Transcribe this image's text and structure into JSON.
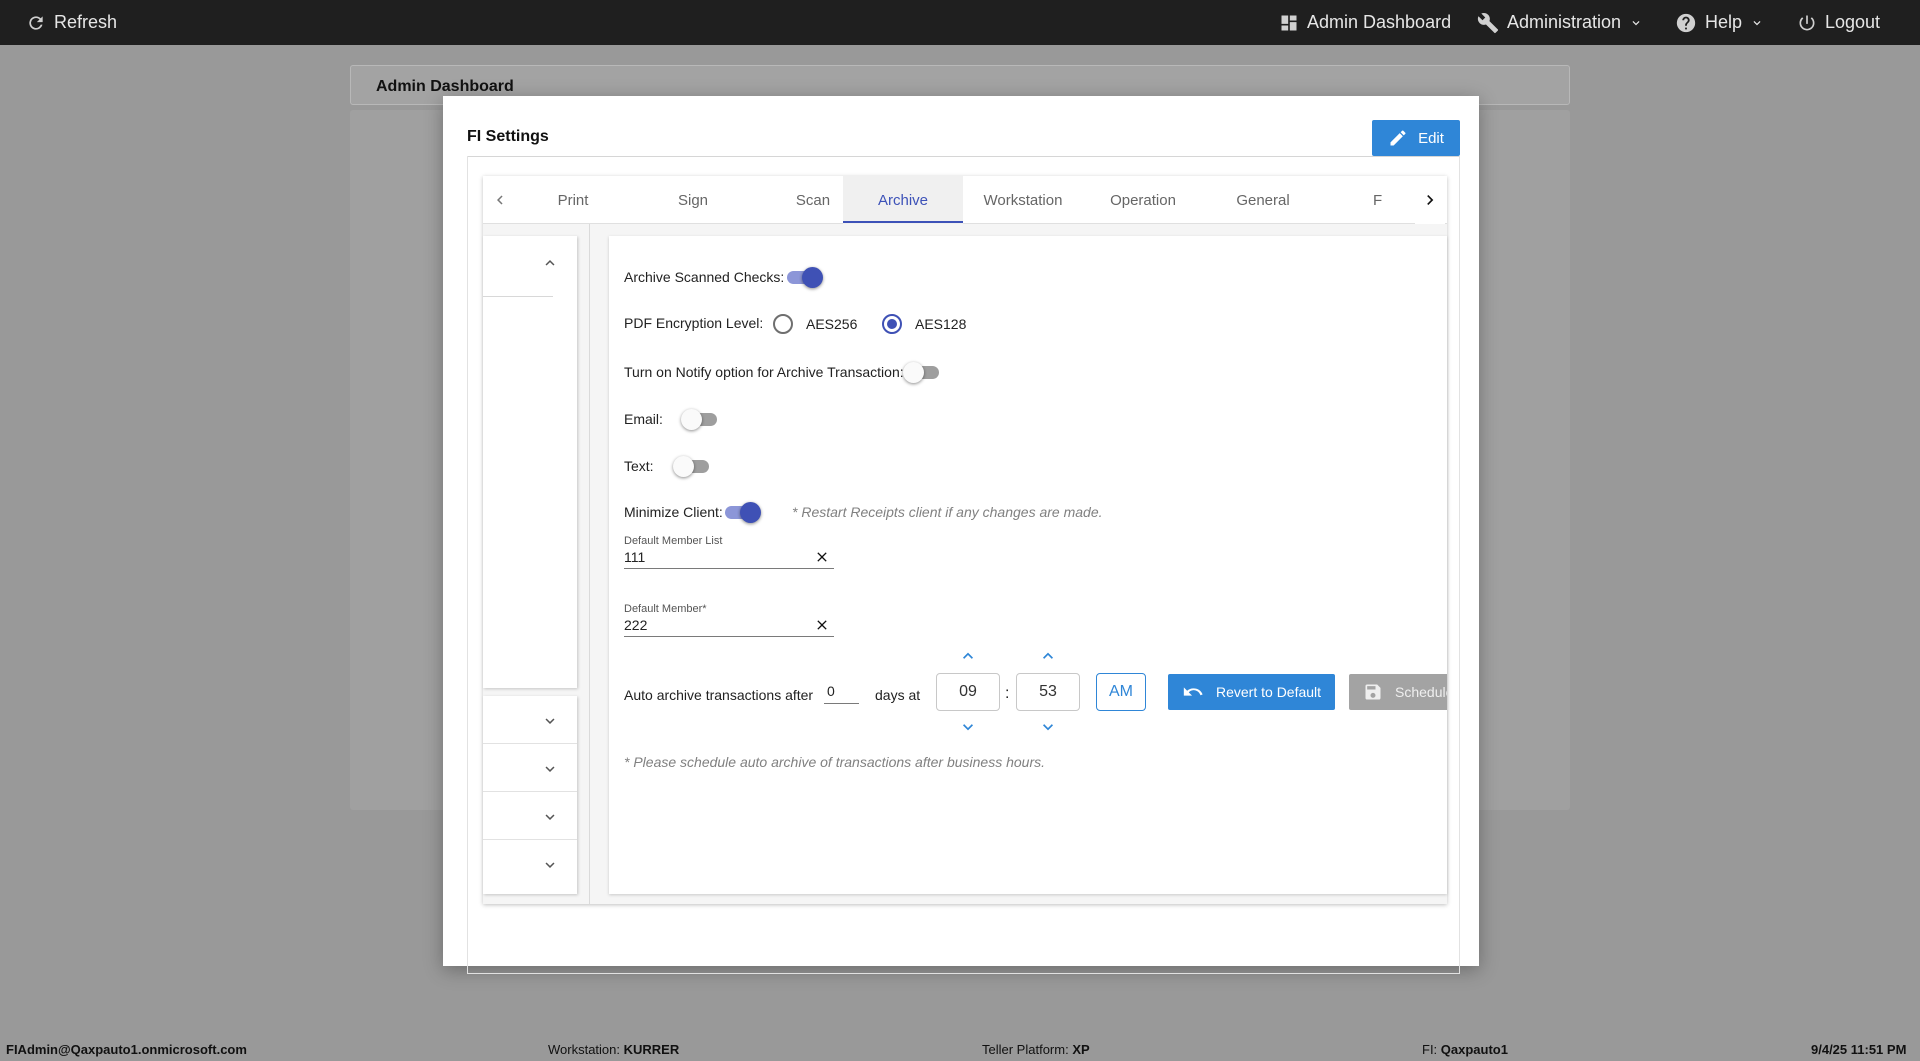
{
  "topbar": {
    "refresh": "Refresh",
    "admin_dashboard": "Admin Dashboard",
    "administration": "Administration",
    "help": "Help",
    "logout": "Logout"
  },
  "background": {
    "header_title": "Admin Dashboard"
  },
  "modal": {
    "title": "FI Settings",
    "edit_label": "Edit",
    "tabs": [
      {
        "label": "Print"
      },
      {
        "label": "Sign"
      },
      {
        "label": "Scan"
      },
      {
        "label": "Archive",
        "active": true
      },
      {
        "label": "Workstation"
      },
      {
        "label": "Operation"
      },
      {
        "label": "General"
      },
      {
        "label": "F"
      }
    ]
  },
  "archive": {
    "archive_scanned_checks_label": "Archive Scanned Checks:",
    "archive_scanned_checks_on": true,
    "pdf_encryption_label": "PDF Encryption Level:",
    "pdf_options": [
      "AES256",
      "AES128"
    ],
    "pdf_selected": "AES128",
    "notify_label": "Turn on Notify option for Archive Transaction:",
    "notify_on": false,
    "email_label": "Email:",
    "email_on": false,
    "text_label": "Text:",
    "text_on": false,
    "minimize_client_label": "Minimize Client:",
    "minimize_client_on": true,
    "minimize_client_note": "* Restart Receipts client if any changes are made.",
    "default_member_list_label": "Default Member List",
    "default_member_list_value": "111",
    "default_member_label": "Default Member*",
    "default_member_value": "222",
    "auto_archive_label": "Auto archive transactions after",
    "auto_archive_days": "0",
    "days_at_label": "days at",
    "hour": "09",
    "time_separator": ":",
    "minute": "53",
    "ampm": "AM",
    "revert_label": "Revert to Default",
    "schedule_label": "Schedule",
    "schedule_note": "* Please schedule auto archive of transactions after business hours."
  },
  "footer": {
    "user": "FIAdmin@Qaxpauto1.onmicrosoft.com",
    "workstation_key": "Workstation: ",
    "workstation_value": "KURRER",
    "teller_key": "Teller Platform: ",
    "teller_value": "XP",
    "fi_key": "FI: ",
    "fi_value": "Qaxpauto1",
    "datetime": "9/4/25 11:51 PM"
  },
  "colors": {
    "accent": "#3f51b5",
    "button_blue": "#2f86d7",
    "topbar": "#1f1f1f"
  }
}
